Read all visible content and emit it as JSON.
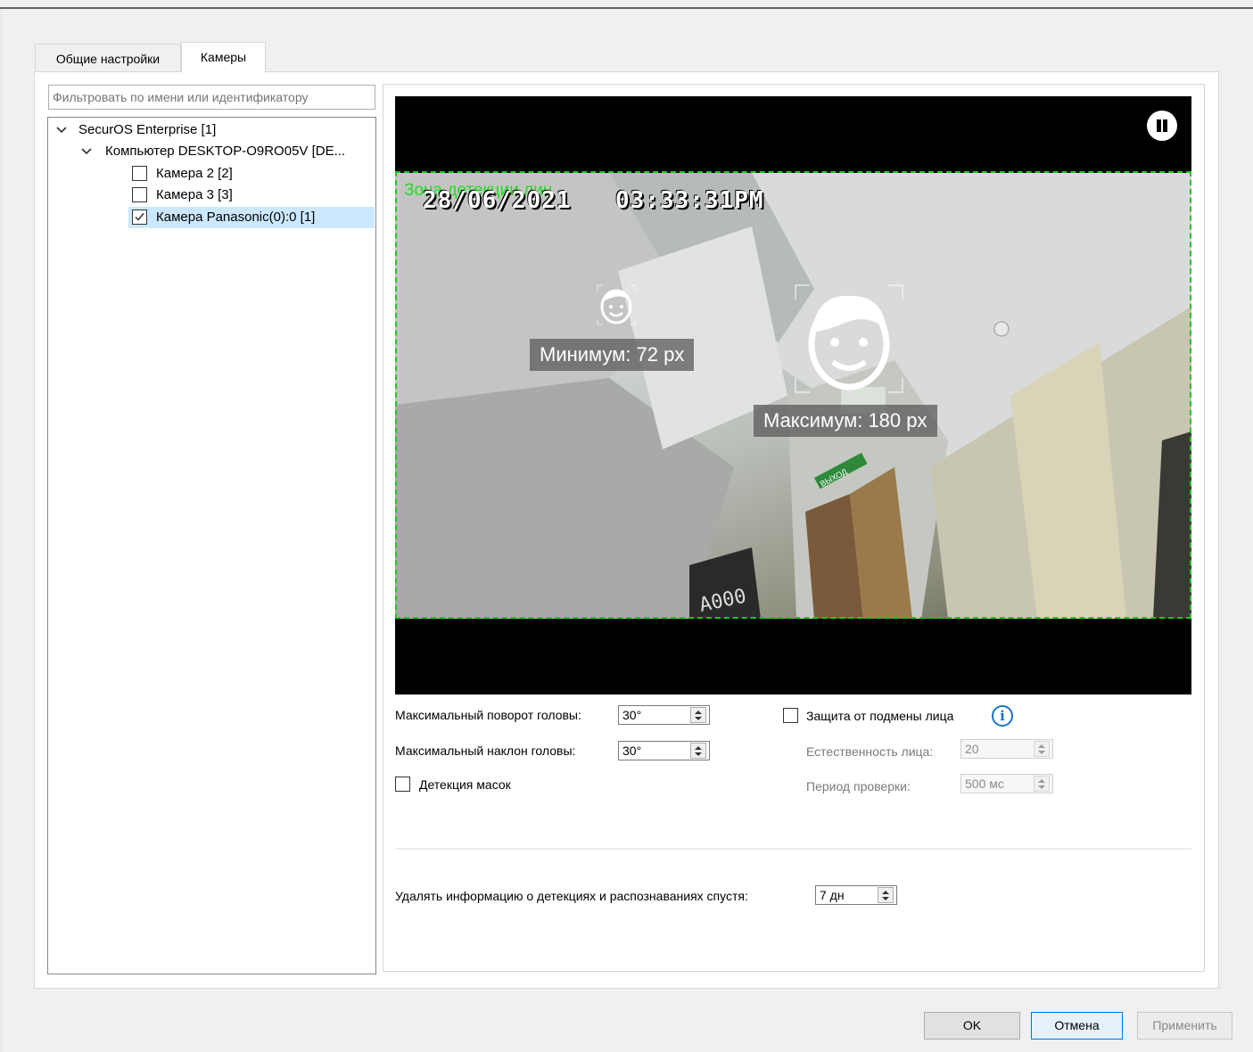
{
  "tabs": [
    {
      "label": "Общие настройки"
    },
    {
      "label": "Камеры"
    }
  ],
  "filter": {
    "placeholder": "Фильтровать по имени или идентификатору"
  },
  "tree": {
    "root": "SecurOS Enterprise [1]",
    "computer": "Компьютер DESKTOP-O9RO05V [DE...",
    "cameras": [
      {
        "label": "Камера 2 [2]",
        "checked": false
      },
      {
        "label": "Камера 3 [3]",
        "checked": false
      },
      {
        "label": "Камера Panasonic(0):0 [1]",
        "checked": true
      }
    ]
  },
  "video": {
    "zone_label": "Зона детекции лиц",
    "date": "28/06/2021",
    "time": "03:33:31PM",
    "min_label": "Минимум: 72 px",
    "max_label": "Максимум: 180 px",
    "plate_text": "A000",
    "exit_sign": "ВЫХОД"
  },
  "settings": {
    "max_rotation_label": "Максимальный поворот головы:",
    "max_rotation_value": "30°",
    "max_tilt_label": "Максимальный наклон головы:",
    "max_tilt_value": "30°",
    "mask_detection_label": "Детекция масок",
    "spoof_protection_label": "Защита от подмены лица",
    "naturalness_label": "Естественность лица:",
    "naturalness_value": "20",
    "check_period_label": "Период проверки:",
    "check_period_value": "500 мс",
    "delete_info_label": "Удалять информацию о детекциях и распознаваниях спустя:",
    "delete_info_value": "7 дн"
  },
  "buttons": {
    "ok": "OK",
    "cancel": "Отмена",
    "apply": "Применить"
  },
  "colors": {
    "zone": "#1ec81e",
    "selection": "#cce8ff",
    "info": "#1a73c8"
  }
}
